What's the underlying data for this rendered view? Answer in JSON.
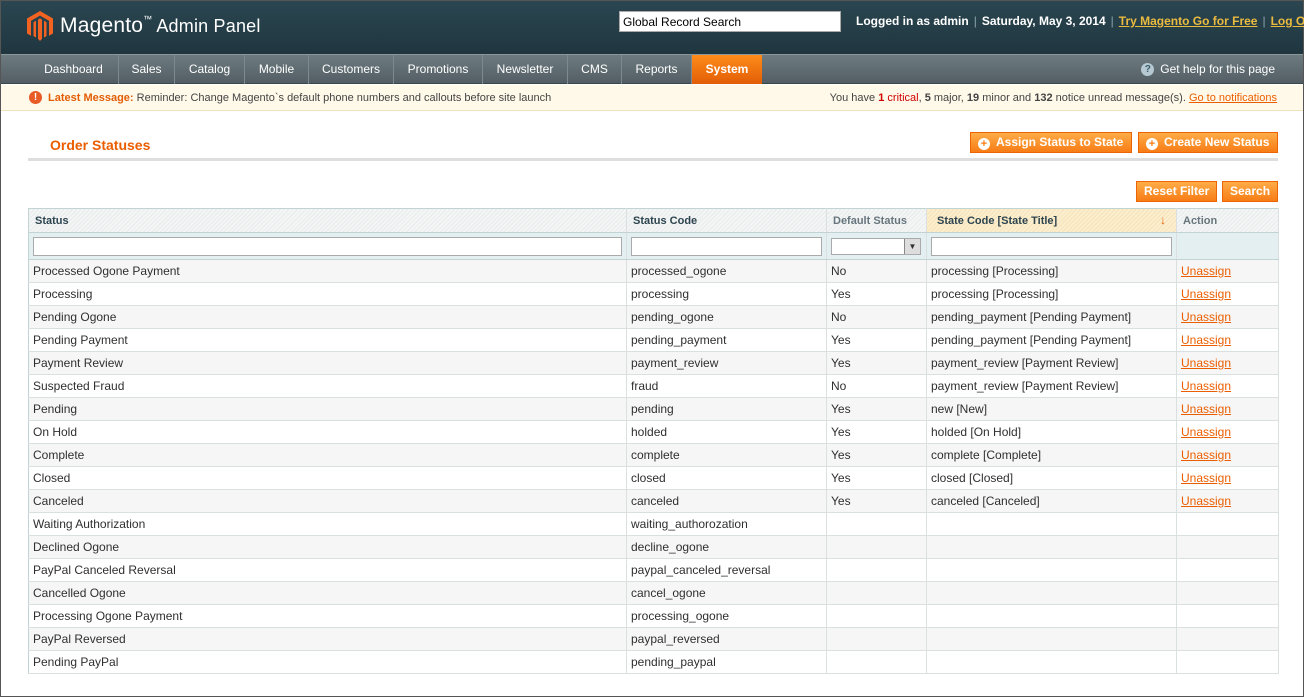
{
  "header": {
    "logo_brand": "Magento",
    "logo_tm": "™",
    "logo_sub": "Admin Panel",
    "search_value": "Global Record Search",
    "logged_in": "Logged in as admin",
    "date": "Saturday, May 3, 2014",
    "try_link": "Try Magento Go for Free",
    "logout": "Log Out"
  },
  "nav": {
    "items": [
      "Dashboard",
      "Sales",
      "Catalog",
      "Mobile",
      "Customers",
      "Promotions",
      "Newsletter",
      "CMS",
      "Reports",
      "System"
    ],
    "active": "System",
    "help": "Get help for this page"
  },
  "messages": {
    "latest_label": "Latest Message:",
    "latest_text": "Reminder: Change Magento`s default phone numbers and callouts before site launch",
    "summary_prefix": "You have",
    "critical_count": "1",
    "critical_label": "critical",
    "major_count": "5",
    "major_label": "major",
    "minor_count": "19",
    "minor_label": "minor and",
    "notice_count": "132",
    "notice_label": "notice unread message(s).",
    "link": "Go to notifications"
  },
  "page": {
    "title": "Order Statuses",
    "assign_button": "Assign Status to State",
    "create_button": "Create New Status",
    "reset_button": "Reset Filter",
    "search_button": "Search"
  },
  "grid": {
    "columns": [
      "Status",
      "Status Code",
      "Default Status",
      "State Code [State Title]",
      "Action"
    ],
    "rows": [
      {
        "status": "Processed Ogone Payment",
        "code": "processed_ogone",
        "default": "No",
        "state": "processing [Processing]",
        "action": "Unassign"
      },
      {
        "status": "Processing",
        "code": "processing",
        "default": "Yes",
        "state": "processing [Processing]",
        "action": "Unassign"
      },
      {
        "status": "Pending Ogone",
        "code": "pending_ogone",
        "default": "No",
        "state": "pending_payment [Pending Payment]",
        "action": "Unassign"
      },
      {
        "status": "Pending Payment",
        "code": "pending_payment",
        "default": "Yes",
        "state": "pending_payment [Pending Payment]",
        "action": "Unassign"
      },
      {
        "status": "Payment Review",
        "code": "payment_review",
        "default": "Yes",
        "state": "payment_review [Payment Review]",
        "action": "Unassign"
      },
      {
        "status": "Suspected Fraud",
        "code": "fraud",
        "default": "No",
        "state": "payment_review [Payment Review]",
        "action": "Unassign"
      },
      {
        "status": "Pending",
        "code": "pending",
        "default": "Yes",
        "state": "new [New]",
        "action": "Unassign"
      },
      {
        "status": "On Hold",
        "code": "holded",
        "default": "Yes",
        "state": "holded [On Hold]",
        "action": "Unassign"
      },
      {
        "status": "Complete",
        "code": "complete",
        "default": "Yes",
        "state": "complete [Complete]",
        "action": "Unassign"
      },
      {
        "status": "Closed",
        "code": "closed",
        "default": "Yes",
        "state": "closed [Closed]",
        "action": "Unassign"
      },
      {
        "status": "Canceled",
        "code": "canceled",
        "default": "Yes",
        "state": "canceled [Canceled]",
        "action": "Unassign"
      },
      {
        "status": "Waiting Authorization",
        "code": "waiting_authorozation",
        "default": "",
        "state": "",
        "action": ""
      },
      {
        "status": "Declined Ogone",
        "code": "decline_ogone",
        "default": "",
        "state": "",
        "action": ""
      },
      {
        "status": "PayPal Canceled Reversal",
        "code": "paypal_canceled_reversal",
        "default": "",
        "state": "",
        "action": ""
      },
      {
        "status": "Cancelled Ogone",
        "code": "cancel_ogone",
        "default": "",
        "state": "",
        "action": ""
      },
      {
        "status": "Processing Ogone Payment",
        "code": "processing_ogone",
        "default": "",
        "state": "",
        "action": ""
      },
      {
        "status": "PayPal Reversed",
        "code": "paypal_reversed",
        "default": "",
        "state": "",
        "action": ""
      },
      {
        "status": "Pending PayPal",
        "code": "pending_paypal",
        "default": "",
        "state": "",
        "action": ""
      }
    ]
  },
  "colors": {
    "header_bg": "#1f363f",
    "accent_orange": "#eb5e00",
    "active_nav": "#e25d06",
    "link_yellow": "#ebbb40"
  }
}
